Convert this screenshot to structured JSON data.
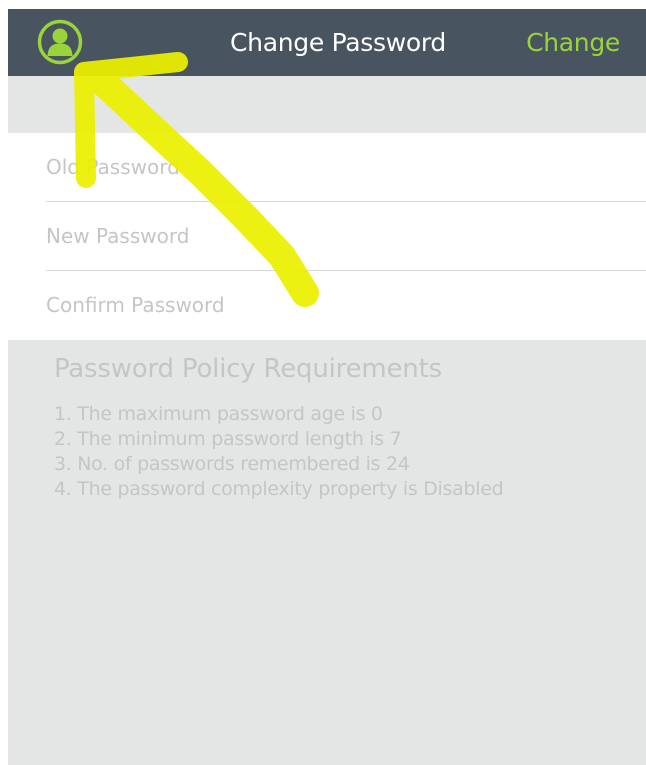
{
  "colors": {
    "navbar_bg": "#485560",
    "accent_green": "#9ad33a",
    "page_bg": "#e4e6e6",
    "annotation_yellow": "#ecf000"
  },
  "navbar": {
    "profile_icon": "user-profile-icon",
    "title": "Change Password",
    "action_label": "Change"
  },
  "form": {
    "old_password_placeholder": "Old Password",
    "new_password_placeholder": "New Password",
    "confirm_password_placeholder": "Confirm Password"
  },
  "policy": {
    "title": "Password Policy Requirements",
    "items": [
      "1. The maximum password age is 0",
      "2. The minimum password length is 7",
      "3. No. of passwords remembered is 24",
      "4. The password complexity property is Disabled"
    ]
  },
  "annotation": {
    "type": "arrow",
    "icon": "yellow-arrow-icon",
    "points_to": "user-profile-icon"
  }
}
